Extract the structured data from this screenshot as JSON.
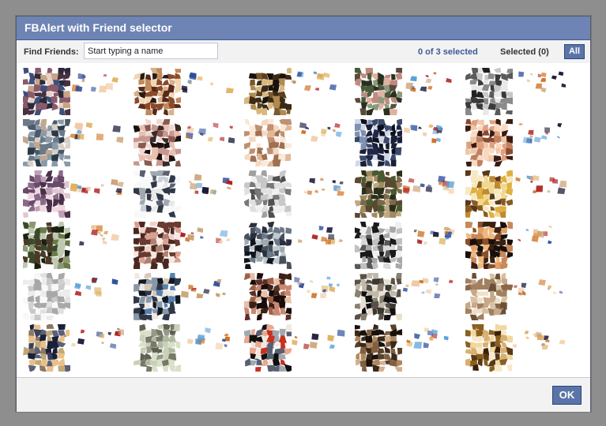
{
  "dialog": {
    "title": "FBAlert with Friend selector"
  },
  "toolbar": {
    "find_label": "Find Friends:",
    "search_placeholder": "Start typing a name",
    "selection_count": "0 of 3 selected",
    "selected_label": "Selected (0)",
    "all_button": "All"
  },
  "friends": {
    "rows": 6,
    "columns": 5,
    "photo_palettes": [
      [
        "#2b2a3d",
        "#8a5a6b",
        "#3d4f7a",
        "#c7a487",
        "#4a3040",
        "#e8d0c2"
      ],
      [
        "#d8b08a",
        "#5a2a18",
        "#f2d6b3",
        "#8a4a28",
        "#2a1a10",
        "#c08a5a"
      ],
      [
        "#3a2a14",
        "#7a5a2a",
        "#1a1208",
        "#b08a50",
        "#5a4020",
        "#d8b880"
      ],
      [
        "#4a5a3a",
        "#c08a80",
        "#2a3020",
        "#8a9a7a",
        "#e0b0a0",
        "#5a4a3a"
      ],
      [
        "#8a8a8a",
        "#3a3a3a",
        "#c8c8c8",
        "#5a5a5a",
        "#e8e8e8",
        "#202020"
      ],
      [
        "#4a5a6a",
        "#8a9aa8",
        "#2a3a48",
        "#c0a890",
        "#6a7a88",
        "#d8d0c8"
      ],
      [
        "#c89890",
        "#3a2a28",
        "#e8c0b0",
        "#8a5a50",
        "#1a1010",
        "#f0d8d0"
      ],
      [
        "#e0b898",
        "#f4d8c0",
        "#c09070",
        "#fae8d8",
        "#a07050",
        "#ffffff"
      ],
      [
        "#1a2038",
        "#0a1020",
        "#3a4a6a",
        "#d0d8e8",
        "#202848",
        "#8090b0"
      ],
      [
        "#c08060",
        "#f0c8a8",
        "#3a1a10",
        "#e0a080",
        "#8a4a30",
        "#fad8c0"
      ],
      [
        "#c0a0b8",
        "#6a4a68",
        "#e0c8d0",
        "#8a6a88",
        "#f0d8e0",
        "#4a3048"
      ],
      [
        "#303848",
        "#e8e8e8",
        "#a0a8b0",
        "#c8d0d8",
        "#5a6070",
        "#f8f8f8"
      ],
      [
        "#a0a0a0",
        "#e0e0e0",
        "#505050",
        "#c8c8c8",
        "#787878",
        "#f0f0f0"
      ],
      [
        "#4a5a30",
        "#7a6a4a",
        "#2a3018",
        "#a08a60",
        "#5a4830",
        "#c0a880"
      ],
      [
        "#e0b040",
        "#8a5a20",
        "#f0d890",
        "#c08830",
        "#5a3818",
        "#f8e8c0"
      ],
      [
        "#3a4a28",
        "#1a2010",
        "#6a7a48",
        "#c0c8b0",
        "#4a3a28",
        "#8a9a70"
      ],
      [
        "#f0d0c8",
        "#6a3a30",
        "#d8a090",
        "#fae8e0",
        "#4a2820",
        "#b08070"
      ],
      [
        "#2a3040",
        "#6a7888",
        "#10141c",
        "#c0c8d0",
        "#48505c",
        "#a0a8b0"
      ],
      [
        "#d8d8d8",
        "#1a1a1a",
        "#a8a8a8",
        "#f0f0f0",
        "#585858",
        "#c0c0c0"
      ],
      [
        "#c88858",
        "#3a2010",
        "#f0b880",
        "#8a5028",
        "#1a0e08",
        "#e0a068"
      ],
      [
        "#e0e0e0",
        "#c8c8c8",
        "#f8f8f8",
        "#a8a8a8",
        "#ececec",
        "#d0d0d0"
      ],
      [
        "#303848",
        "#d8c8b8",
        "#8898a8",
        "#101820",
        "#f0e8e0",
        "#5880b0"
      ],
      [
        "#3a2018",
        "#a06048",
        "#1a0c08",
        "#c88870",
        "#5a3028",
        "#e8c0a8"
      ],
      [
        "#3a3830",
        "#c0b8a8",
        "#101010",
        "#888070",
        "#e8e0d0",
        "#5a5048"
      ],
      [
        "#a08060",
        "#d8c0a0",
        "#6a5038",
        "#f0e0c8",
        "#8a6848",
        "#c8a888"
      ],
      [
        "#3a4058",
        "#e8c088",
        "#1a2038",
        "#8a7860",
        "#5a6078",
        "#c0a878"
      ],
      [
        "#b0b8a0",
        "#787868",
        "#d8e0c8",
        "#989888",
        "#c8d0b8",
        "#606050"
      ],
      [
        "#101010",
        "#c83020",
        "#f0e8e0",
        "#586070",
        "#a0a8b0",
        "#e8a890"
      ],
      [
        "#3a2818",
        "#806040",
        "#1a1008",
        "#b08860",
        "#5a4028",
        "#d0b090"
      ],
      [
        "#8a6020",
        "#f0d8a0",
        "#5a3810",
        "#d8b070",
        "#3a2008",
        "#f8e8c8"
      ]
    ],
    "name_palette": [
      "#2a4a9a",
      "#d07020",
      "#1a1a3a",
      "#e0b060",
      "#b02020",
      "#5aa0d8",
      "#c8a070",
      "#f0c8a0"
    ]
  }
}
